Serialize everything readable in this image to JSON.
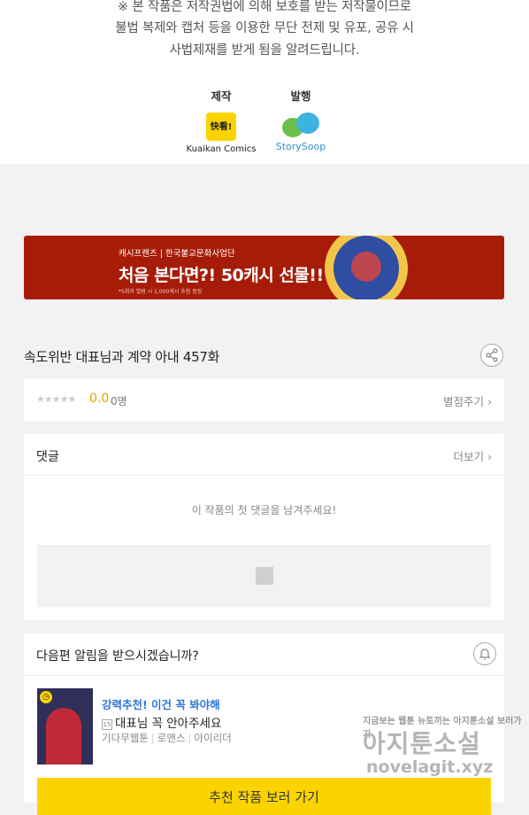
{
  "copyright": {
    "lines": [
      "※ 본 작품은 저작권법에 의해 보호를 받는 저작물이므로",
      "불법 복제와 캡처 등을 이용한 무단 전제 및 유포, 공유 시",
      "사법제재를 받게 됨을 알려드립니다."
    ]
  },
  "credits": {
    "production_label": "제작",
    "production_logo_text": "快看!",
    "production_name": "Kuaikan Comics",
    "publisher_label": "발행",
    "publisher_name": "StorySoop"
  },
  "banner": {
    "top_text": "캐시프렌즈 | 한국불교문화사업단",
    "main_text": "처음 본다면?! 50캐시 선물!!",
    "small_text": "*5회차 열람 시 1,000캐시 추첨 증정"
  },
  "episode": {
    "title": "속도위반 대표님과 계약 아내 457화"
  },
  "rating": {
    "stars": "★★★★★",
    "score": "0.0",
    "count": "0명",
    "rate_link": "별점주기 ›"
  },
  "comments": {
    "title": "댓글",
    "more": "더보기 ›",
    "empty_message": "이 작품의 첫 댓글을 남겨주세요!"
  },
  "notify": {
    "title": "다음편 알림을 받으시겠습니까?",
    "rec_label": "강력추천! 이건 꼭 봐야해",
    "age_badge": "15",
    "rec_title": "대표님 꼭 안아주세요",
    "rec_meta": [
      "기다무웹툰",
      "로맨스",
      "아이리더"
    ],
    "button": "추천 작품 보러 가기"
  },
  "watermark": {
    "line1": "지금보는 웹툰 뉴토끼는 아지툰소설 보러가기",
    "line2": "아지툰소설",
    "line3": "novelagit.xyz"
  },
  "colors": {
    "accent_yellow": "#fbd400",
    "banner_red": "#a71c08",
    "score_color": "#e8a100",
    "link_blue": "#2f74d9"
  },
  "icons": {
    "share": "share-icon",
    "bell": "bell-icon",
    "clock": "clock-icon",
    "chevron": "chevron-right-icon"
  }
}
